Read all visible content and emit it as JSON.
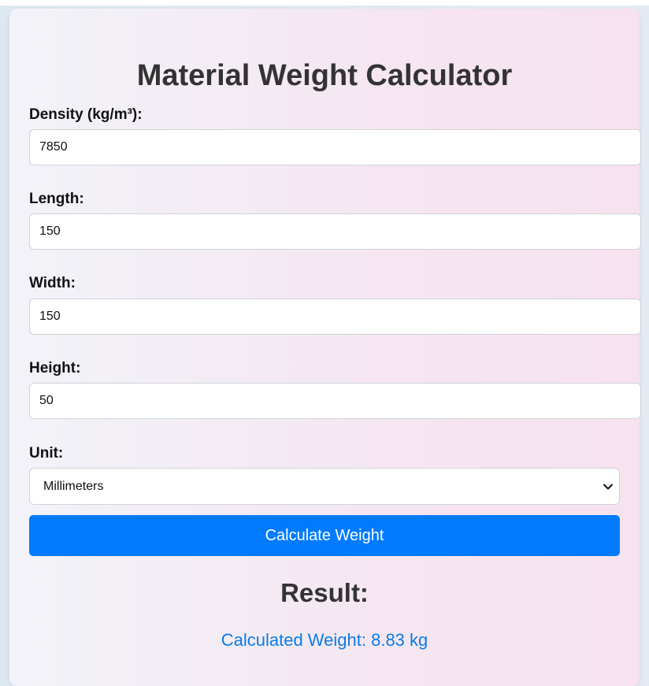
{
  "page": {
    "title": "Material Weight Calculator"
  },
  "form": {
    "density": {
      "label": "Density (kg/m³):",
      "value": "7850"
    },
    "length": {
      "label": "Length:",
      "value": "150"
    },
    "width": {
      "label": "Width:",
      "value": "150"
    },
    "height": {
      "label": "Height:",
      "value": "50"
    },
    "unit": {
      "label": "Unit:",
      "selected": "Millimeters",
      "icon": "chevron-down-icon"
    },
    "calculate_label": "Calculate Weight"
  },
  "result": {
    "heading": "Result:",
    "text": "Calculated Weight: 8.83 kg"
  },
  "colors": {
    "accent": "#007bff",
    "result_text": "#0a7ce6",
    "heading": "#333333"
  }
}
